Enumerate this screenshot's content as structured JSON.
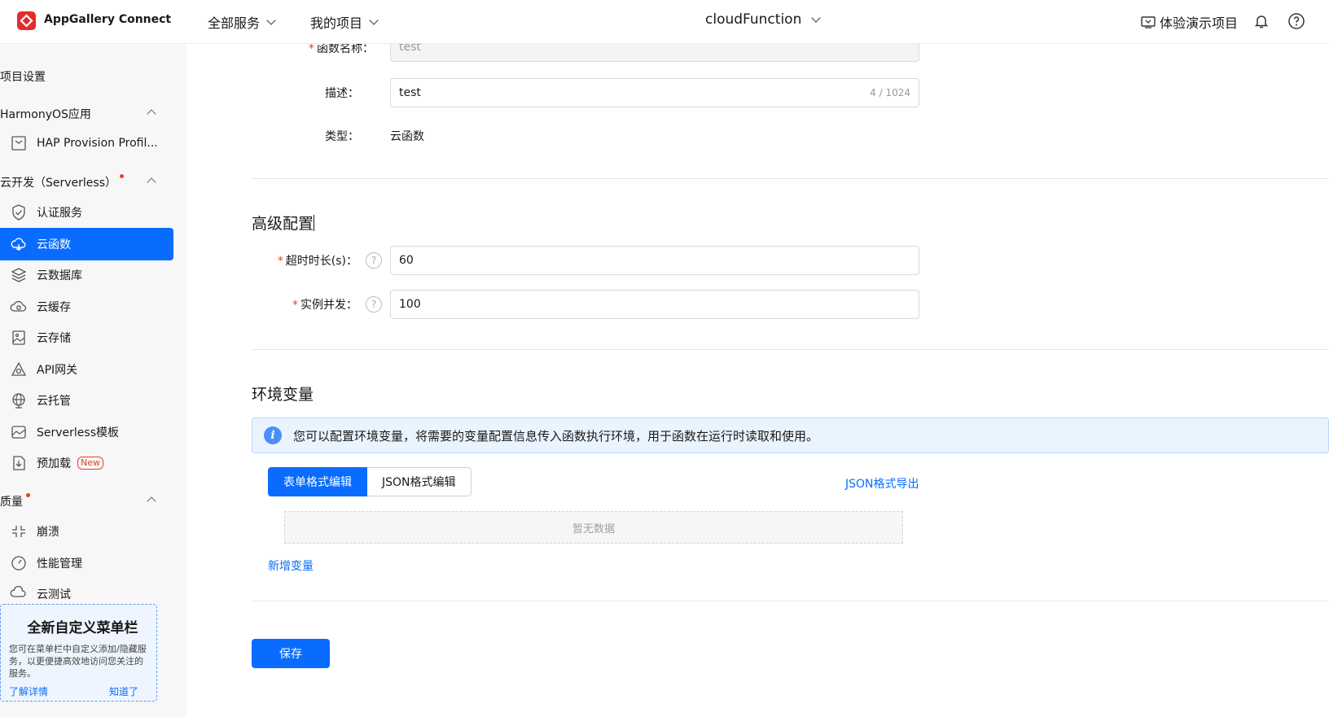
{
  "topbar": {
    "brand": "AppGallery Connect",
    "nav_all_services": "全部服务",
    "nav_my_projects": "我的项目",
    "project_name": "cloudFunction",
    "demo_project": "体验演示项目"
  },
  "sidebar": {
    "project_settings": "项目设置",
    "group_harmony": "HarmonyOS应用",
    "item_hap": "HAP Provision Profil...",
    "group_serverless": "云开发（Serverless）",
    "items": [
      {
        "label": "认证服务"
      },
      {
        "label": "云函数"
      },
      {
        "label": "云数据库"
      },
      {
        "label": "云缓存"
      },
      {
        "label": "云存储"
      },
      {
        "label": "API网关"
      },
      {
        "label": "云托管"
      },
      {
        "label": "Serverless模板"
      },
      {
        "label": "预加载"
      }
    ],
    "new_badge": "New",
    "group_quality": "质量",
    "quality_items": [
      {
        "label": "崩溃"
      },
      {
        "label": "性能管理"
      },
      {
        "label": "云测试"
      }
    ],
    "promo_title": "全新自定义菜单栏",
    "promo_text": "您可在菜单栏中自定义添加/隐藏服务，以更便捷高效地访问您关注的服务。",
    "promo_learn": "了解详情",
    "promo_ok": "知道了"
  },
  "form": {
    "name_label": "函数名称：",
    "name_value": "test",
    "desc_label": "描述：",
    "desc_value": "test",
    "desc_counter": "4 / 1024",
    "type_label": "类型：",
    "type_value": "云函数"
  },
  "advanced": {
    "title": "高级配置",
    "timeout_label": "超时时长(s)：",
    "timeout_value": "60",
    "concurrency_label": "实例并发：",
    "concurrency_value": "100"
  },
  "env": {
    "title": "环境变量",
    "notice": "您可以配置环境变量，将需要的变量配置信息传入函数执行环境，用于函数在运行时读取和使用。",
    "tab_form": "表单格式编辑",
    "tab_json": "JSON格式编辑",
    "export_json": "JSON格式导出",
    "empty": "暂无数据",
    "add_variable": "新增变量"
  },
  "save_label": "保存",
  "colors": {
    "accent": "#0a6cff",
    "required": "#e84026"
  }
}
